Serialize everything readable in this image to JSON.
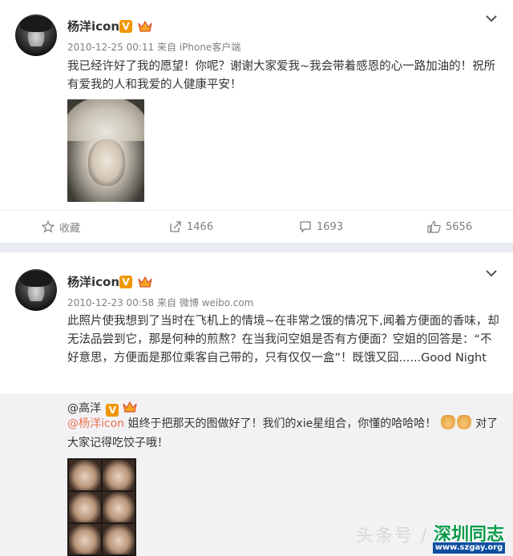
{
  "posts": [
    {
      "username": "杨洋icon",
      "verified_badge": "V",
      "timestamp": "2010-12-25 00:11",
      "source_prefix": "来自",
      "source": "iPhone客户端",
      "text": "我已经许好了我的愿望！你呢？谢谢大家爱我~我会带着感恩的心一路加油的！祝所有爱我的人和我爱的人健康平安！",
      "actions": {
        "favorite_label": "收藏",
        "repost_count": "1466",
        "comment_count": "1693",
        "like_count": "5656"
      }
    },
    {
      "username": "杨洋icon",
      "verified_badge": "V",
      "timestamp": "2010-12-23 00:58",
      "source_prefix": "来自",
      "source": "微博 weibo.com",
      "text": "此照片使我想到了当时在飞机上的情境~在非常之饿的情况下,闻着方便面的香味，却无法品尝到它，那是何种的煎熬？在当我问空姐是否有方便面？空姐的回答是：“不好意思，方便面是那位乘客自己带的，只有仅仅一盒”！既饿又囧......Good Night",
      "repost": {
        "user": "@高洋",
        "verified_badge": "V",
        "mention": "@杨洋icon",
        "text_before": " 姐终于把那天的图做好了！我们的xie星组合，你懂的哈哈哈！",
        "text_after": "对了大家记得吃饺子哦！"
      }
    }
  ],
  "watermark": {
    "text": "头条号 /",
    "logo_title": "深圳同志",
    "logo_url": "www.szgay.org"
  },
  "colors": {
    "badge_orange": "#f09700",
    "mention": "#eb7350",
    "logo_green": "#0a9a4a",
    "logo_blue": "#0e4ea1"
  },
  "icons": [
    "chevron-down-icon",
    "crown-icon",
    "star-icon",
    "repost-icon",
    "comment-icon",
    "like-icon",
    "hand-v-icon"
  ]
}
